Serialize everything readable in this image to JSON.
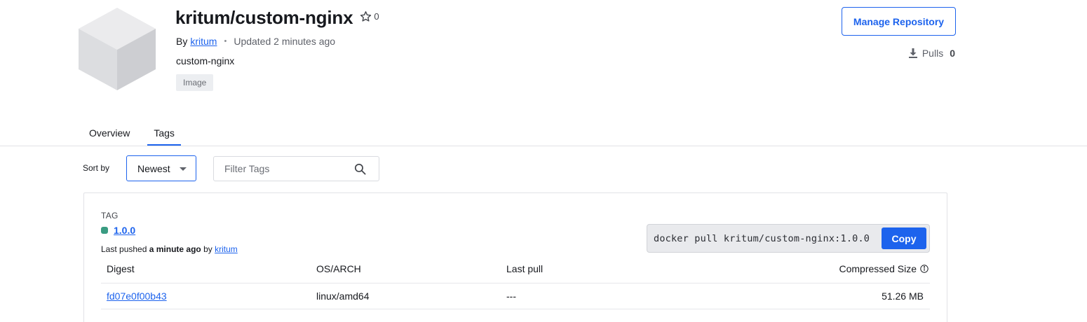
{
  "repo": {
    "title": "kritum/custom-nginx",
    "stars": "0",
    "by_prefix": "By",
    "owner": "kritum",
    "separator": "•",
    "updated": "Updated 2 minutes ago",
    "description": "custom-nginx",
    "badge": "Image"
  },
  "actions": {
    "manage_label": "Manage Repository",
    "pulls_label": "Pulls",
    "pulls_count": "0"
  },
  "tabs": [
    {
      "label": "Overview",
      "active": false
    },
    {
      "label": "Tags",
      "active": true
    }
  ],
  "controls": {
    "sort_label": "Sort by",
    "sort_value": "Newest",
    "filter_placeholder": "Filter Tags"
  },
  "tag": {
    "heading": "TAG",
    "name": "1.0.0",
    "status_color": "#3a9c82",
    "pushed_prefix": "Last pushed",
    "pushed_time": "a minute ago",
    "pushed_by": "by",
    "pushed_user": "kritum",
    "pull_command": "docker pull kritum/custom-nginx:1.0.0",
    "copy_label": "Copy"
  },
  "table": {
    "headers": [
      "Digest",
      "OS/ARCH",
      "Last pull",
      "Compressed Size"
    ],
    "rows": [
      {
        "digest": "fd07e0f00b43",
        "os_arch": "linux/amd64",
        "last_pull": "---",
        "size": "51.26 MB"
      }
    ]
  },
  "colors": {
    "accent": "#1d63ed",
    "text": "#17191e",
    "muted": "#5e6169"
  }
}
